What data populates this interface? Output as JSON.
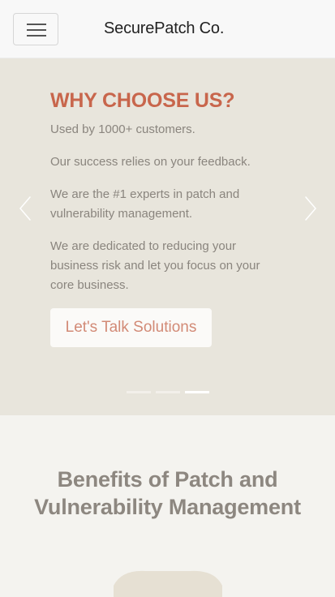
{
  "navbar": {
    "brand": "SecurePatch Co.",
    "toggle_icon": "hamburger-menu-icon"
  },
  "carousel": {
    "title": "WHY CHOOSE US?",
    "lines": [
      "Used by 1000+ customers.",
      "Our success relies on your feedback.",
      "We are the #1 experts in patch and vulnerability management.",
      "We are dedicated to reducing your business risk and let you focus on your core business."
    ],
    "cta_label": "Let's Talk Solutions",
    "prev_icon": "chevron-left-icon",
    "next_icon": "chevron-right-icon",
    "slide_count": 3,
    "active_slide": 3
  },
  "benefits": {
    "title": "Benefits of Patch and Vulnerability Management"
  },
  "colors": {
    "title_accent": "#c8664c",
    "cta_text": "#d28a76",
    "carousel_bg": "#e8e5dc",
    "page_bg": "#f4f3ef"
  }
}
